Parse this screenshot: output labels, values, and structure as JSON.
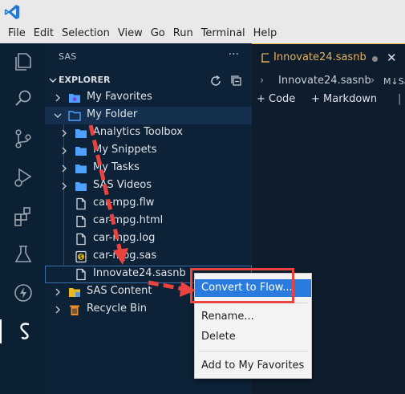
{
  "menu": [
    "File",
    "Edit",
    "Selection",
    "View",
    "Go",
    "Run",
    "Terminal",
    "Help"
  ],
  "activity_bar": [
    "explorer-icon",
    "search-icon",
    "source-control-icon",
    "run-debug-icon",
    "extensions-icon",
    "testing-icon",
    "lightning-icon",
    "sas-icon"
  ],
  "sidebar": {
    "title": "SAS",
    "more": "···",
    "explorer_label": "EXPLORER",
    "tree": [
      {
        "label": "My Favorites",
        "icon": "favorites-folder-icon"
      },
      {
        "label": "My Folder",
        "icon": "folder-icon"
      },
      {
        "label": "Analytics Toolbox",
        "icon": "folder-icon"
      },
      {
        "label": "My Snippets",
        "icon": "folder-icon"
      },
      {
        "label": "My Tasks",
        "icon": "folder-icon"
      },
      {
        "label": "SAS Videos",
        "icon": "folder-icon"
      },
      {
        "label": "car-mpg.flw",
        "icon": "file-icon"
      },
      {
        "label": "car-mpg.html",
        "icon": "file-icon"
      },
      {
        "label": "car-mpg.log",
        "icon": "file-icon"
      },
      {
        "label": "car-mpg.sas",
        "icon": "sas-file-icon"
      },
      {
        "label": "Innovate24.sasnb",
        "icon": "file-icon"
      },
      {
        "label": "SAS Content",
        "icon": "sas-content-icon"
      },
      {
        "label": "Recycle Bin",
        "icon": "recycle-bin-icon"
      }
    ]
  },
  "editor": {
    "tab_name": "Innovate24.sasnb",
    "breadcrumb_file": "Innovate24.sasnb",
    "breadcrumb_more": "M↓Sa",
    "code_btn": "+ Code",
    "markdown_btn": "+ Markdown"
  },
  "context_menu": {
    "items": [
      "Convert to Flow...",
      "Rename...",
      "Delete",
      "Add to My Favorites"
    ]
  },
  "colors": {
    "accent": "#2a7bde",
    "annotation": "#e8433f",
    "tab_title": "#e5b05a"
  }
}
